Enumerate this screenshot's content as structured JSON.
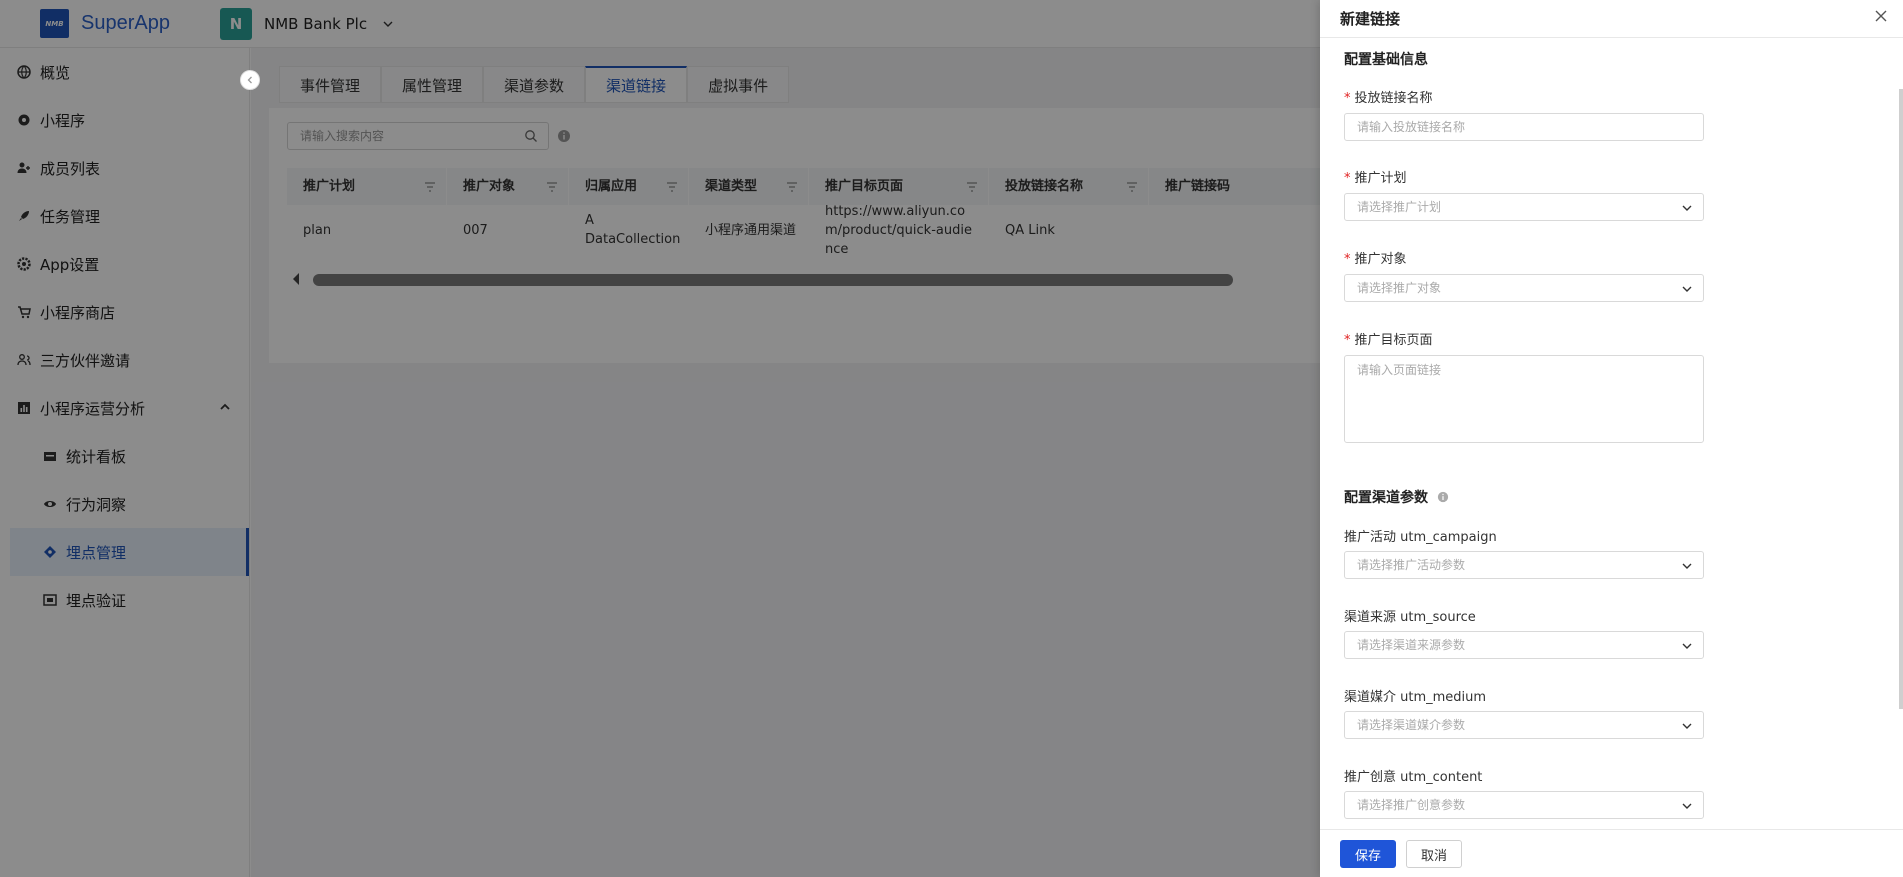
{
  "topbar": {
    "logo_text": "NMB",
    "app_name": "SuperApp",
    "org_initial": "N",
    "org_name": "NMB Bank Plc"
  },
  "sidebar": {
    "items": [
      {
        "label": "概览",
        "icon": "globe-icon"
      },
      {
        "label": "小程序",
        "icon": "gear-icon"
      },
      {
        "label": "成员列表",
        "icon": "user-add-icon"
      },
      {
        "label": "任务管理",
        "icon": "rocket-icon"
      },
      {
        "label": "App设置",
        "icon": "settings-icon"
      },
      {
        "label": "小程序商店",
        "icon": "cart-icon"
      },
      {
        "label": "三方伙伴邀请",
        "icon": "team-icon"
      },
      {
        "label": "小程序运营分析",
        "icon": "bar-chart-icon"
      }
    ],
    "sub_items": [
      {
        "label": "统计看板",
        "icon": "dashboard-icon"
      },
      {
        "label": "行为洞察",
        "icon": "eye-icon"
      },
      {
        "label": "埋点管理",
        "icon": "tag-icon",
        "active": true
      },
      {
        "label": "埋点验证",
        "icon": "verify-icon"
      }
    ]
  },
  "main": {
    "tabs": [
      "事件管理",
      "属性管理",
      "渠道参数",
      "渠道链接",
      "虚拟事件"
    ],
    "active_tab": "渠道链接",
    "search_placeholder": "请输入搜索内容",
    "table": {
      "columns": [
        "推广计划",
        "推广对象",
        "归属应用",
        "渠道类型",
        "推广目标页面",
        "投放链接名称",
        "推广链接码"
      ],
      "rows": [
        [
          "plan",
          "007",
          "A DataCollection",
          "小程序通用渠道",
          "https://www.aliyun.com/product/quick-audience",
          "QA Link",
          ""
        ]
      ]
    }
  },
  "drawer": {
    "title": "新建链接",
    "section_basic": "配置基础信息",
    "section_channel": "配置渠道参数",
    "fields": {
      "link_name": {
        "label": "投放链接名称",
        "placeholder": "请输入投放链接名称",
        "required": true
      },
      "plan": {
        "label": "推广计划",
        "placeholder": "请选择推广计划",
        "required": true
      },
      "target": {
        "label": "推广对象",
        "placeholder": "请选择推广对象",
        "required": true
      },
      "page": {
        "label": "推广目标页面",
        "placeholder": "请输入页面链接",
        "required": true
      },
      "campaign": {
        "label": "推广活动 utm_campaign",
        "placeholder": "请选择推广活动参数"
      },
      "source": {
        "label": "渠道来源 utm_source",
        "placeholder": "请选择渠道来源参数"
      },
      "medium": {
        "label": "渠道媒介 utm_medium",
        "placeholder": "请选择渠道媒介参数"
      },
      "content": {
        "label": "推广创意 utm_content",
        "placeholder": "请选择推广创意参数"
      }
    },
    "save_label": "保存",
    "cancel_label": "取消"
  },
  "colors": {
    "accent": "#1f55b8",
    "primary_button": "#1f55d8",
    "required": "#e02020"
  }
}
